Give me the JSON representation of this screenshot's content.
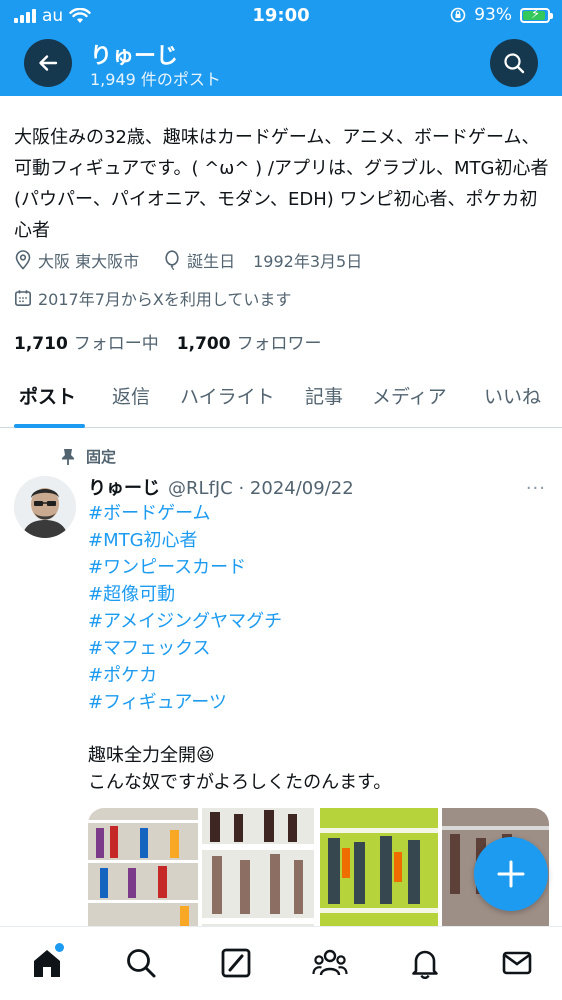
{
  "status_bar": {
    "carrier": "au",
    "time": "19:00",
    "battery": "93%",
    "battery_level": 0.93
  },
  "header": {
    "name": "りゅーじ",
    "post_count": "1,949 件のポスト"
  },
  "profile": {
    "bio": "大阪住みの32歳、趣味はカードゲーム、アニメ、ボードゲーム、可動フィギュアです。( ^ω^ ) /アプリは、グラブル、MTG初心者 (パウパー、パイオニア、モダン、EDH) ワンピ初心者、ポケカ初心者",
    "location": "大阪 東大阪市",
    "birthday_label": "誕生日",
    "birthday": "1992年3月5日",
    "joined": "2017年7月からXを利用しています",
    "following_count": "1,710",
    "following_label": "フォロー中",
    "followers_count": "1,700",
    "followers_label": "フォロワー"
  },
  "tabs": [
    "ポスト",
    "返信",
    "ハイライト",
    "記事",
    "メディア",
    "いいね"
  ],
  "active_tab": "ポスト",
  "post": {
    "pinned_label": "固定",
    "author_name": "りゅーじ",
    "handle_date": "@RLfJC · 2024/09/22",
    "more": "···",
    "hashtags": [
      "#ボードゲーム",
      "#MTG初心者",
      "#ワンピースカード",
      "#超像可動",
      "#アメイジングヤマグチ",
      "#マフェックス",
      "#ポケカ",
      "#フィギュアーツ"
    ],
    "text_line1": "趣味全力全開😆",
    "text_line2": "こんな奴ですがよろしくたのんます。"
  },
  "nav": {
    "items": [
      "home-icon",
      "search-icon",
      "grok-icon",
      "communities-icon",
      "notifications-icon",
      "messages-icon"
    ]
  },
  "colors": {
    "accent": "#1d9bf0",
    "header_button": "#16384f",
    "text_secondary": "#536471"
  }
}
